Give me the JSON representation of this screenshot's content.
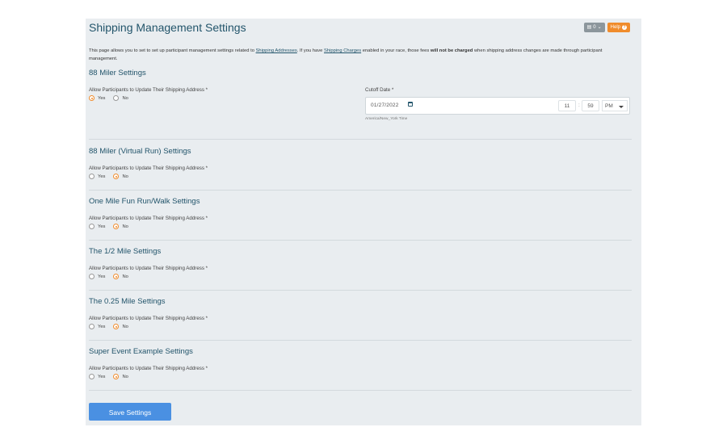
{
  "header": {
    "title": "Shipping Management Settings",
    "counter_label": "0",
    "help_label": "Help"
  },
  "intro": {
    "text_1": "This page allows you to set to set up participant management settings related to ",
    "link_1": "Shipping Addresses",
    "text_2": ". If you have ",
    "link_2": "Shipping Charges",
    "text_3": " enabled in your race, those fees ",
    "bold": "will not be charged",
    "text_4": " when shipping address changes are made through participant management."
  },
  "sections": [
    {
      "title": "88 Miler Settings",
      "label": "Allow Participants to Update Their Shipping Address *",
      "yes": "Yes",
      "no": "No",
      "selected": "yes"
    },
    {
      "title": "88 Miler (Virtual Run) Settings",
      "label": "Allow Participants to Update Their Shipping Address *",
      "yes": "Yes",
      "no": "No",
      "selected": "no"
    },
    {
      "title": "One Mile Fun Run/Walk Settings",
      "label": "Allow Participants to Update Their Shipping Address *",
      "yes": "Yes",
      "no": "No",
      "selected": "no"
    },
    {
      "title": "The 1/2 Mile Settings",
      "label": "Allow Participants to Update Their Shipping Address *",
      "yes": "Yes",
      "no": "No",
      "selected": "no"
    },
    {
      "title": "The 0.25 Mile Settings",
      "label": "Allow Participants to Update Their Shipping Address *",
      "yes": "Yes",
      "no": "No",
      "selected": "no"
    },
    {
      "title": "Super Event Example Settings",
      "label": "Allow Participants to Update Their Shipping Address *",
      "yes": "Yes",
      "no": "No",
      "selected": "no"
    }
  ],
  "cutoff": {
    "label": "Cutoff Date *",
    "date": "01/27/2022",
    "hour": "11",
    "minute": "59",
    "ampm": "PM",
    "timezone": "America/New_York Time"
  },
  "save_label": "Save Settings",
  "colors": {
    "accent": "#f08c2c",
    "title": "#23556b",
    "button": "#4a90e2",
    "panel": "#e9edf0"
  }
}
